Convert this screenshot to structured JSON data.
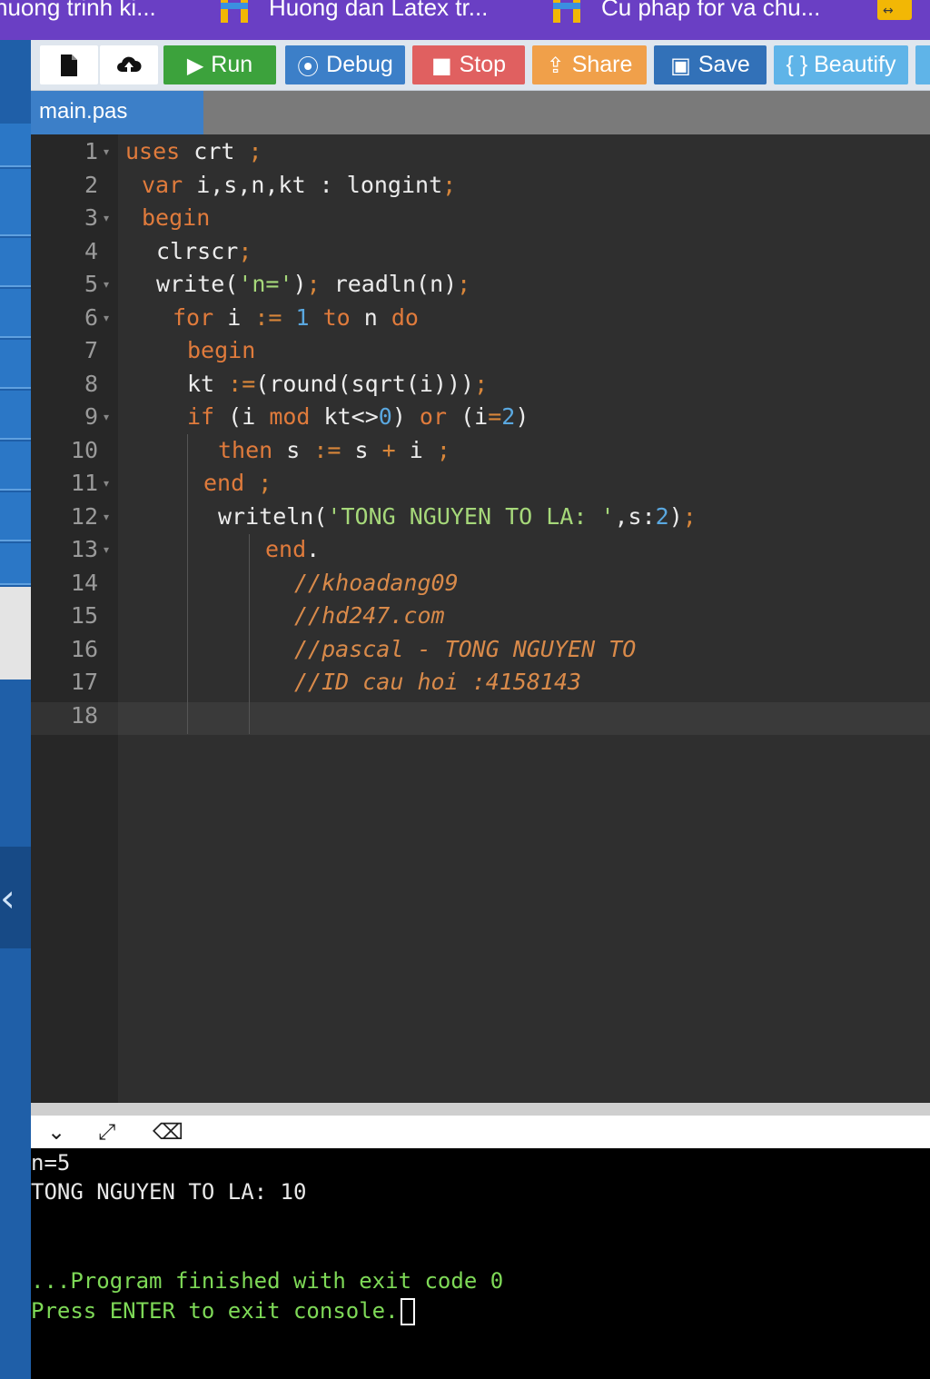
{
  "browser_tabs": [
    {
      "label": "nuong trinh ki..."
    },
    {
      "label": "Huong dan Latex tr..."
    },
    {
      "label": "Cu phap for va chu..."
    }
  ],
  "toolbar": {
    "new_icon": "file-icon",
    "upload_icon": "cloud-upload-icon",
    "run_label": "Run",
    "debug_label": "Debug",
    "stop_label": "Stop",
    "share_label": "Share",
    "save_label": "Save",
    "beautify_label": "{ } Beautify"
  },
  "file_tab": {
    "name": "main.pas"
  },
  "editor": {
    "line_numbers": [
      "1",
      "2",
      "3",
      "4",
      "5",
      "6",
      "7",
      "8",
      "9",
      "10",
      "11",
      "12",
      "13",
      "14",
      "15",
      "16",
      "17",
      "18"
    ],
    "code": {
      "l1_a": "uses",
      "l1_b": " crt ",
      "l1_c": ";",
      "l2_a": "var",
      "l2_b": " i,s,n,kt : longint",
      "l2_c": ";",
      "l3_a": "begin",
      "l4_a": "clrscr",
      "l4_b": ";",
      "l5_a": "write(",
      "l5_b": "'n='",
      "l5_c": ")",
      "l5_d": ";",
      "l5_e": " readln(n)",
      "l5_f": ";",
      "l6_a": "for",
      "l6_b": " i ",
      "l6_c": ":=",
      "l6_d": " ",
      "l6_e": "1",
      "l6_f": " ",
      "l6_g": "to",
      "l6_h": " n ",
      "l6_i": "do",
      "l7_a": "begin",
      "l8_a": "kt ",
      "l8_b": ":=",
      "l8_c": "(round(sqrt(i)))",
      "l8_d": ";",
      "l9_a": "if",
      "l9_b": " (i ",
      "l9_c": "mod",
      "l9_d": " kt<>",
      "l9_e": "0",
      "l9_f": ") ",
      "l9_g": "or",
      "l9_h": " (i",
      "l9_i": "=",
      "l9_j": "2",
      "l9_k": ")",
      "l10_a": "then",
      "l10_b": " s ",
      "l10_c": ":=",
      "l10_d": " s ",
      "l10_e": "+",
      "l10_f": " i ",
      "l10_g": ";",
      "l11_a": "end",
      "l11_b": " ;",
      "l12_a": "writeln(",
      "l12_b": "'TONG NGUYEN TO LA: '",
      "l12_c": ",s:",
      "l12_d": "2",
      "l12_e": ")",
      "l12_f": ";",
      "l13_a": "end",
      "l13_b": ".",
      "l14_a": "//khoadang09",
      "l15_a": "//hd247.com",
      "l16_a": "//pascal - TONG NGUYEN TO",
      "l17_a": "//ID cau hoi :4158143"
    }
  },
  "console": {
    "line1": "n=5",
    "line2": "TONG NGUYEN TO LA: 10",
    "line3": "...Program finished with exit code 0",
    "line4": "Press ENTER to exit console."
  },
  "colors": {
    "keyword": "#e07b3c",
    "number": "#5aa8e0",
    "string": "#a6d87a",
    "run": "#3ca23c",
    "stop": "#e06060",
    "share": "#f0a04a"
  }
}
